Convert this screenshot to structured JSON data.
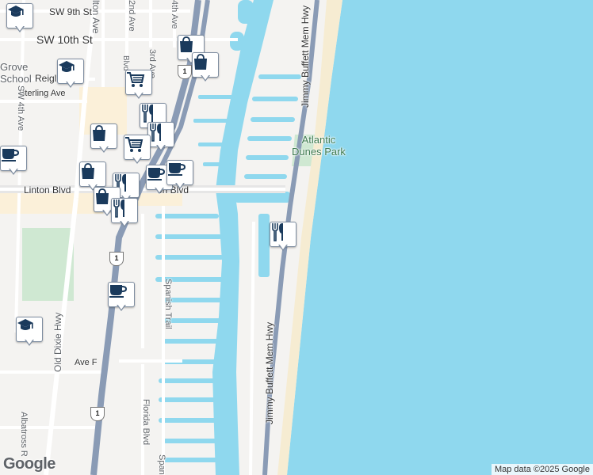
{
  "map": {
    "roads": {
      "sw_9th_st": "SW 9th St",
      "sw_10th_st": "SW 10th St",
      "lyon_ave": "lton Ave",
      "second_ave": "2nd Ave",
      "third_ave": "3rd Ave",
      "fourth_ave": "4th Ave",
      "reigl": "Reigl",
      "sterling_ave": "Sterling Ave",
      "sw_4th_ave": "SW 4th Ave",
      "linton_blvd": "Linton Blvd",
      "linton_blvd_east": "on Blvd",
      "jimmy_buffett_north": "Jimmy Buffett Mem Hwy",
      "jimmy_buffett_south": "Jimmy Buffett Mem Hwy",
      "spanish_trail": "Spanish Trail",
      "spanish_trail_south": "Span",
      "old_dixie_hwy": "Old Dixie Hwy",
      "ave_f": "Ave F",
      "florida_blvd": "Florida Blvd",
      "albatross": "Albatross R",
      "blvd_fragment": "Blvd"
    },
    "places": {
      "park_line1": "Atlantic",
      "park_line2": "Dunes Park",
      "school_line1": "Grove",
      "school_line2": "School"
    },
    "shields": [
      "1",
      "1",
      "1"
    ],
    "pois": [
      {
        "icon": "school-icon"
      },
      {
        "icon": "shopping-icon"
      },
      {
        "icon": "shopping-icon"
      },
      {
        "icon": "school-icon"
      },
      {
        "icon": "grocery-icon"
      },
      {
        "icon": "restaurant-icon"
      },
      {
        "icon": "restaurant-icon"
      },
      {
        "icon": "shopping-icon"
      },
      {
        "icon": "grocery-icon"
      },
      {
        "icon": "coffee-icon"
      },
      {
        "icon": "shopping-icon"
      },
      {
        "icon": "restaurant-icon"
      },
      {
        "icon": "coffee-icon"
      },
      {
        "icon": "coffee-icon"
      },
      {
        "icon": "shopping-icon"
      },
      {
        "icon": "restaurant-icon"
      },
      {
        "icon": "restaurant-icon"
      },
      {
        "icon": "coffee-icon"
      },
      {
        "icon": "school-icon"
      }
    ],
    "colors": {
      "water": "#8fd8ee",
      "land": "#f4f3f1",
      "road": "#ffffff",
      "highway": "#8a9bb5",
      "park": "#cfe8d2",
      "commercial": "#fbf0d9",
      "poi_icon": "#1a3a5c"
    }
  },
  "google_logo": "Google",
  "attribution": "Map data ©2025 Google"
}
